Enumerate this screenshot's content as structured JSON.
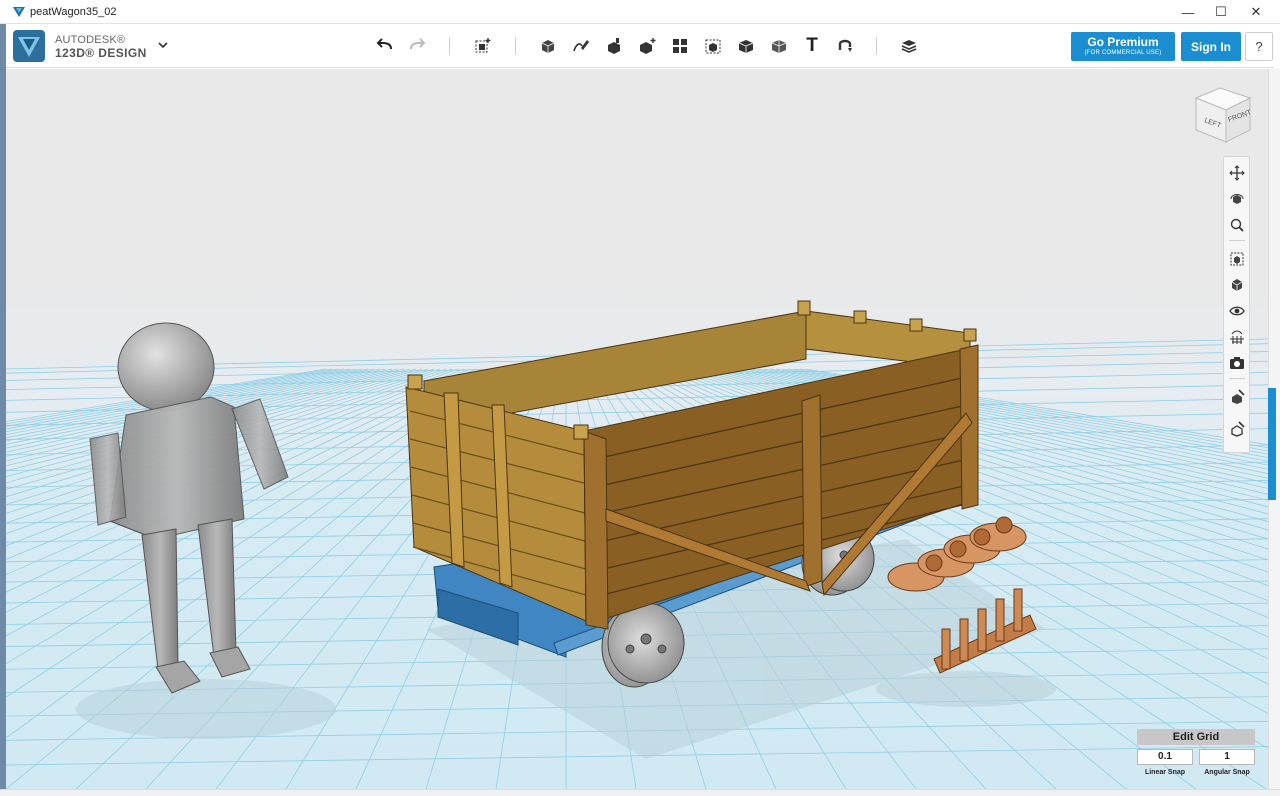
{
  "window": {
    "title": "peatWagon35_02",
    "controls": {
      "minimize": "—",
      "maximize": "☐",
      "close": "✕"
    }
  },
  "brand": {
    "line1": "AUTODESK®",
    "line2": "123D® DESIGN"
  },
  "toolbar": {
    "tools": [
      {
        "id": "undo",
        "icon": "undo-icon"
      },
      {
        "id": "redo",
        "icon": "redo-icon"
      },
      {
        "id": "transform",
        "icon": "transform-icon"
      },
      {
        "id": "primitives",
        "icon": "primitives-icon"
      },
      {
        "id": "sketch",
        "icon": "sketch-icon"
      },
      {
        "id": "construct",
        "icon": "construct-icon"
      },
      {
        "id": "modify",
        "icon": "modify-icon"
      },
      {
        "id": "pattern",
        "icon": "pattern-icon"
      },
      {
        "id": "grouping",
        "icon": "grouping-icon"
      },
      {
        "id": "combine",
        "icon": "combine-icon"
      },
      {
        "id": "measure",
        "icon": "measure-icon"
      },
      {
        "id": "text",
        "icon": "text-icon",
        "glyph": "T"
      },
      {
        "id": "snap",
        "icon": "snap-magnet-icon"
      },
      {
        "id": "material",
        "icon": "material-layers-icon"
      }
    ],
    "go_premium": "Go Premium",
    "go_premium_sub": "(FOR COMMERCIAL USE)",
    "sign_in": "Sign In",
    "help": "?"
  },
  "viewcube": {
    "left": "LEFT",
    "front": "FRONT"
  },
  "navbar": {
    "items": [
      "pan-icon",
      "orbit-icon",
      "zoom-icon",
      "fit-icon",
      "view-mode-icon",
      "visibility-icon",
      "grid-visibility-icon",
      "screenshot-icon",
      "material-icon",
      "outline-icon"
    ]
  },
  "grid": {
    "title": "Edit Grid",
    "linear_value": "0.1",
    "angular_value": "1",
    "linear_label": "Linear Snap",
    "angular_label": "Angular Snap"
  },
  "colors": {
    "accent": "#1a8ed1",
    "grid_line": "#8fcfe6",
    "wood_light": "#b48c3c",
    "wood_dark": "#8a5f24",
    "chassis": "#3f86c2",
    "figure": "#9a9a9a",
    "part_copper": "#cd8a55"
  }
}
